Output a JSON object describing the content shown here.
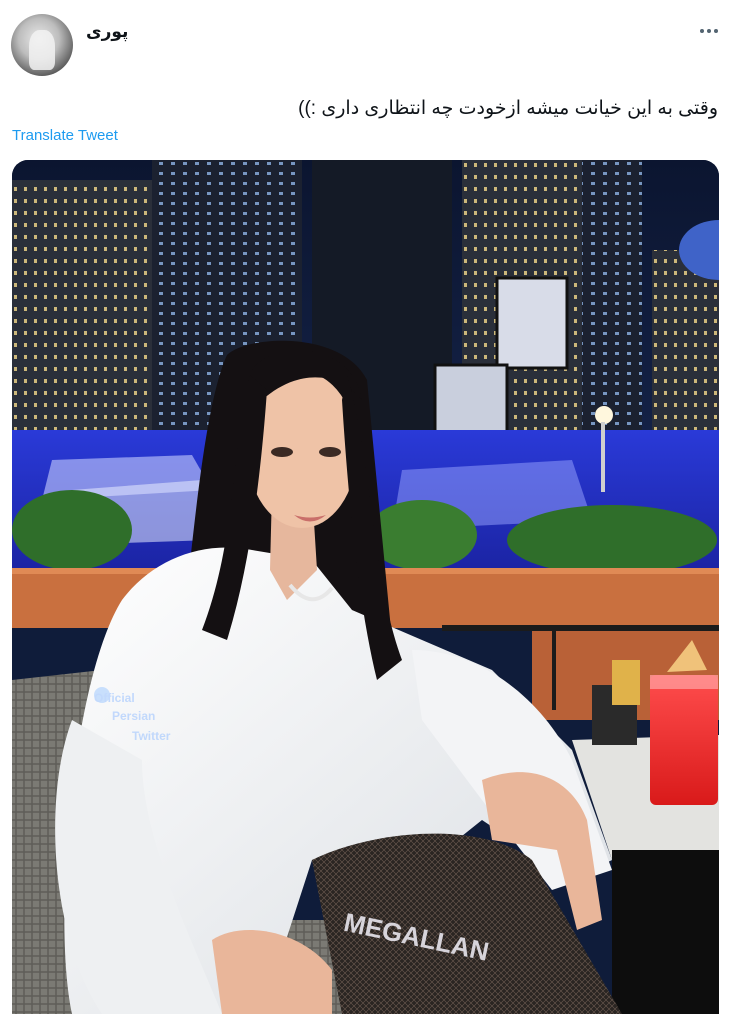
{
  "author": {
    "display_name": "پوری",
    "avatar_icon": "user-avatar"
  },
  "tweet": {
    "text": "وقتی به این خیانت میشه ازخودت چه انتظاری داری :))",
    "translate_label": "Translate Tweet"
  },
  "media": {
    "watermark": [
      "Official",
      "Persian",
      "Twitter"
    ],
    "stocking_text": "MEGALLAN"
  },
  "colors": {
    "link": "#1d9bf0",
    "text": "#0f1419",
    "muted": "#536471"
  }
}
